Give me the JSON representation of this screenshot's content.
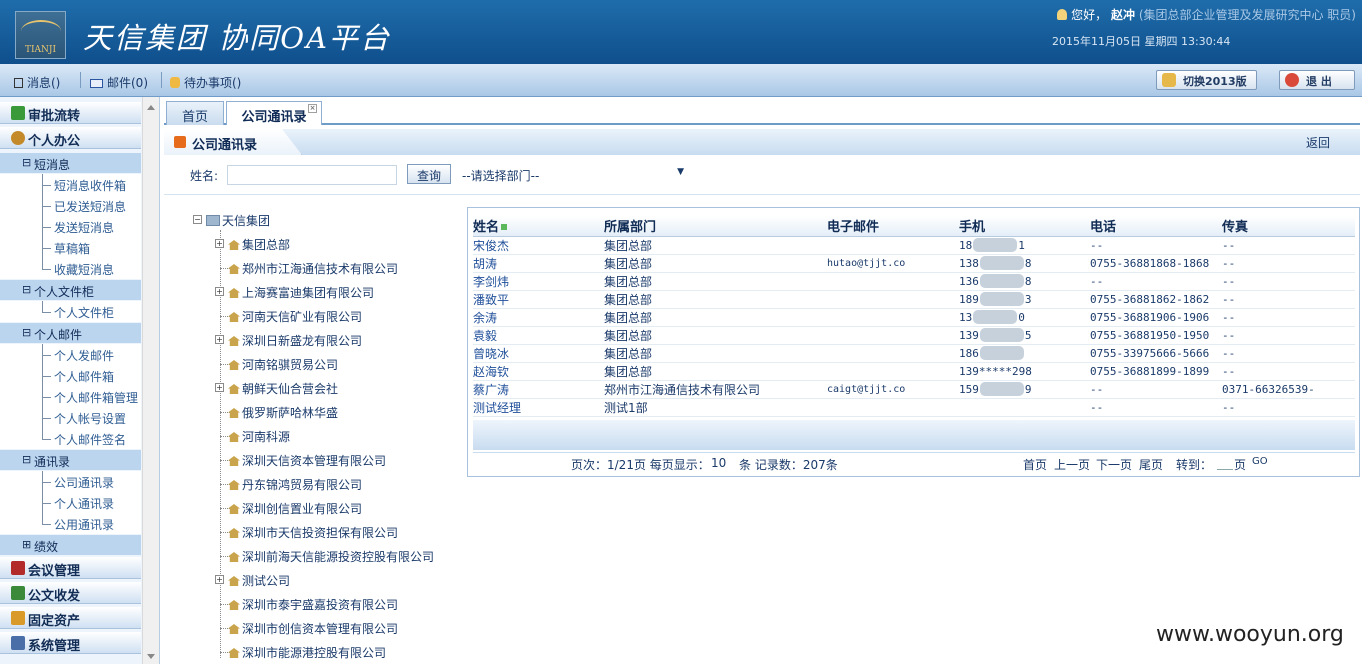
{
  "header": {
    "logo_text": "TIANJI",
    "app_title": "天信集团  协同OA平台",
    "greeting": "您好，",
    "user_name": "赵冲",
    "user_dept": "(集团总部企业管理及发展研究中心 职员)",
    "datetime": "2015年11月05日 星期四 13:30:44"
  },
  "toolbar": {
    "messages": "消息()",
    "mail": "邮件(0)",
    "todo": "待办事项()",
    "switch_btn": "切换2013版",
    "logout_btn": "退 出"
  },
  "sidebar": {
    "approval": "审批流转",
    "personal": "个人办公",
    "sms": "短消息",
    "sms_items": [
      "短消息收件箱",
      "已发送短消息",
      "发送短消息",
      "草稿箱",
      "收藏短消息"
    ],
    "filecab": "个人文件柜",
    "filecab_items": [
      "个人文件柜"
    ],
    "pmail": "个人邮件",
    "pmail_items": [
      "个人发邮件",
      "个人邮件箱",
      "个人邮件箱管理",
      "个人帐号设置",
      "个人邮件签名"
    ],
    "contacts": "通讯录",
    "contacts_items": [
      "公司通讯录",
      "个人通讯录",
      "公用通讯录"
    ],
    "perf": "绩效",
    "meeting": "会议管理",
    "docs": "公文收发",
    "assets": "固定资产",
    "system": "系统管理"
  },
  "tabs": [
    {
      "label": "首页"
    },
    {
      "label": "公司通讯录"
    }
  ],
  "panel": {
    "title": "公司通讯录",
    "back": "返回"
  },
  "search": {
    "name_label": "姓名:",
    "name_value": "",
    "query_btn": "查询",
    "dept_select": "--请选择部门--"
  },
  "tree": {
    "root": "天信集团",
    "nodes": [
      "集团总部",
      "郑州市江海通信技术有限公司",
      "上海赛富迪集团有限公司",
      "河南天信矿业有限公司",
      "深圳日新盛龙有限公司",
      "河南铭骐贸易公司",
      "朝鲜天仙合营会社",
      "俄罗斯萨哈林华盛",
      "河南科源",
      "深圳天信资本管理有限公司",
      "丹东锦鸿贸易有限公司",
      "深圳创信置业有限公司",
      "深圳市天信投资担保有限公司",
      "深圳前海天信能源投资控股有限公司",
      "测试公司",
      "深圳市泰宇盛嘉投资有限公司",
      "深圳市创信资本管理有限公司",
      "深圳市能源港控股有限公司"
    ]
  },
  "grid": {
    "columns": [
      "姓名",
      "所属部门",
      "电子邮件",
      "手机",
      "电话",
      "传真"
    ],
    "rows": [
      {
        "name": "宋俊杰",
        "dept": "集团总部",
        "email": "",
        "mobile_a": "18",
        "mobile_b": "1",
        "phone": "--",
        "fax": "--"
      },
      {
        "name": "胡涛",
        "dept": "集团总部",
        "email": "hutao@tjjt.co",
        "mobile_a": "138",
        "mobile_b": "8",
        "phone": "0755-36881868-1868",
        "fax": "--"
      },
      {
        "name": "李剑炜",
        "dept": "集团总部",
        "email": "",
        "mobile_a": "136",
        "mobile_b": "8",
        "phone": "--",
        "fax": "--"
      },
      {
        "name": "潘致平",
        "dept": "集团总部",
        "email": "",
        "mobile_a": "189",
        "mobile_b": "3",
        "phone": "0755-36881862-1862",
        "fax": "--"
      },
      {
        "name": "余涛",
        "dept": "集团总部",
        "email": "",
        "mobile_a": "13",
        "mobile_b": "0",
        "phone": "0755-36881906-1906",
        "fax": "--"
      },
      {
        "name": "袁毅",
        "dept": "集团总部",
        "email": "",
        "mobile_a": "139",
        "mobile_b": "5",
        "phone": "0755-36881950-1950",
        "fax": "--"
      },
      {
        "name": "曾晓冰",
        "dept": "集团总部",
        "email": "",
        "mobile_a": "186",
        "mobile_b": "",
        "phone": "0755-33975666-5666",
        "fax": "--"
      },
      {
        "name": "赵海钦",
        "dept": "集团总部",
        "email": "",
        "mobile_a": "139*****298",
        "mobile_b": "",
        "phone": "0755-36881899-1899",
        "fax": "--"
      },
      {
        "name": "蔡广涛",
        "dept": "郑州市江海通信技术有限公司",
        "email": "caigt@tjjt.co",
        "mobile_a": "159",
        "mobile_b": "9",
        "phone": "--",
        "fax": "0371-66326539-"
      },
      {
        "name": "测试经理",
        "dept": "测试1部",
        "email": "",
        "mobile_a": "",
        "mobile_b": "",
        "phone": "--",
        "fax": "--"
      }
    ]
  },
  "pager": {
    "pageinfo": "页次：1/21页  每页显示：",
    "perpage": "10",
    "records": "条  记录数：207条",
    "first": "首页",
    "prev": "上一页",
    "next": "下一页",
    "last": "尾页",
    "goto": "转到：",
    "page": "页",
    "go": "GO"
  },
  "watermark": "www.wooyun.org",
  "colors": {
    "header_bg": "#1f6dab",
    "sidebar_bg": "#eef4fb",
    "accent": "#e66b1b"
  }
}
